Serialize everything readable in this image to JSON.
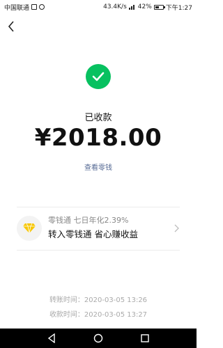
{
  "status_bar": {
    "carrier": "中国联通",
    "net_speed": "43.4K/s",
    "battery": "42%",
    "time": "下午1:27"
  },
  "receipt": {
    "status_label": "已收款",
    "amount": "¥2018.00",
    "view_change_link": "查看零钱"
  },
  "promo": {
    "title": "零钱通 七日年化2.39%",
    "subtitle": "转入零钱通 省心赚收益"
  },
  "timestamps": {
    "transfer_time": "转账时间：2020-03-05 13:26",
    "receive_time": "收款时间：2020-03-05 13:27"
  },
  "colors": {
    "success_green": "#07c160",
    "link_blue": "#576b95",
    "diamond_gold": "#f7c600"
  },
  "icons": {
    "back": "back-arrow-icon",
    "success": "check-circle-icon",
    "promo": "diamond-icon",
    "chevron": "chevron-right-icon"
  }
}
